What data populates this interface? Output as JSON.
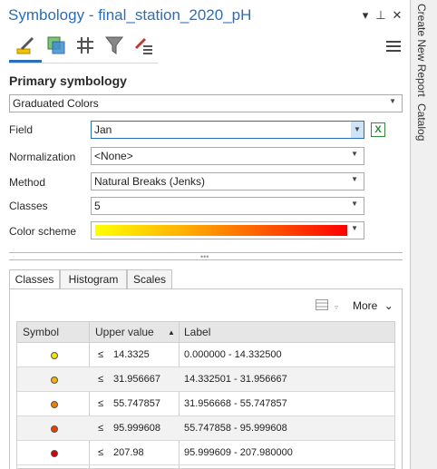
{
  "title": "Symbology - final_station_2020_pH",
  "title_controls": {
    "dropdown": "▾",
    "pin": "⊥",
    "close": "✕"
  },
  "section_title": "Primary symbology",
  "primary_symbology": "Graduated Colors",
  "fields": {
    "field_label": "Field",
    "field_value": "Jan",
    "normalization_label": "Normalization",
    "normalization_value": "<None>",
    "method_label": "Method",
    "method_value": "Natural Breaks (Jenks)",
    "classes_label": "Classes",
    "classes_value": "5",
    "color_scheme_label": "Color scheme"
  },
  "tabs": [
    "Classes",
    "Histogram",
    "Scales"
  ],
  "more_label": "More",
  "table": {
    "headers": {
      "symbol": "Symbol",
      "upper": "Upper value",
      "label": "Label"
    },
    "rows": [
      {
        "le": "≤",
        "upper": "14.3325",
        "label": "0.000000 - 14.332500",
        "color": "#f2e600"
      },
      {
        "le": "≤",
        "upper": "31.956667",
        "label": "14.332501 - 31.956667",
        "color": "#f5b400"
      },
      {
        "le": "≤",
        "upper": "55.747857",
        "label": "31.956668 - 55.747857",
        "color": "#f08000"
      },
      {
        "le": "≤",
        "upper": "95.999608",
        "label": "55.747858 - 95.999608",
        "color": "#e84000"
      },
      {
        "le": "≤",
        "upper": "207.98",
        "label": "95.999609 - 207.980000",
        "color": "#d80000"
      }
    ]
  },
  "sidebar": [
    "Create New Report",
    "Catalog"
  ],
  "colors": {
    "accent": "#2a6ebb",
    "excel_green": "#2f8a3a"
  }
}
